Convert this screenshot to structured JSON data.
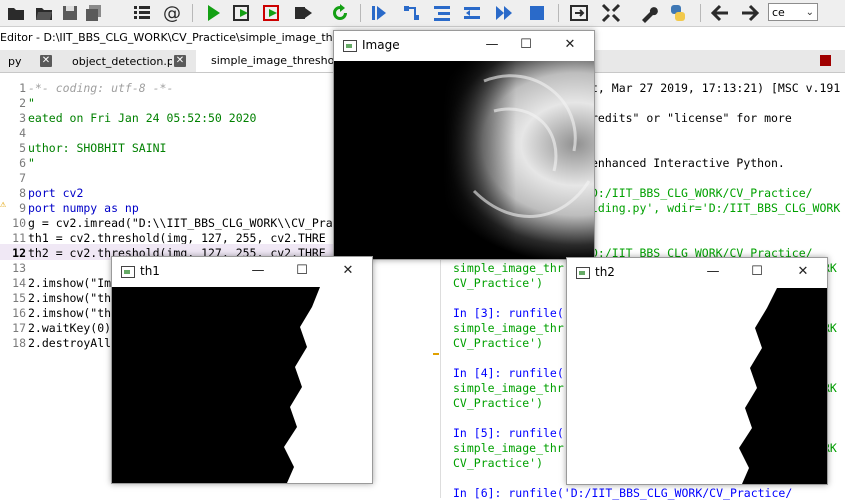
{
  "toolbar": {
    "icons": [
      "folder-open-icon",
      "save-icon",
      "save-all-icon",
      "list-icon",
      "at-icon",
      "run-icon",
      "run-cell-icon",
      "run-cell-advance-icon",
      "run-selection-icon",
      "rerun-icon",
      "debug-icon",
      "step-icon",
      "step-into-icon",
      "step-return-icon",
      "continue-icon",
      "stop-icon",
      "maximize-pane-icon",
      "fullscreen-icon",
      "wrench-icon",
      "python-icon",
      "back-icon",
      "forward-icon"
    ],
    "select_value": "ce"
  },
  "editor": {
    "title": "Editor - D:\\IIT_BBS_CLG_WORK\\CV_Practice\\simple_image_thresholding",
    "tabs": [
      {
        "label": "py"
      },
      {
        "label": "object_detection.py"
      },
      {
        "label": "simple_image_thresholding"
      }
    ],
    "lines": [
      {
        "n": "1",
        "text": "-*- coding: utf-8 -*-"
      },
      {
        "n": "2",
        "text": "\""
      },
      {
        "n": "3",
        "text": "eated on Fri Jan 24 05:52:50 2020"
      },
      {
        "n": "4",
        "text": ""
      },
      {
        "n": "5",
        "text": "uthor: SHOBHIT SAINI"
      },
      {
        "n": "6",
        "text": "\""
      },
      {
        "n": "7",
        "text": ""
      },
      {
        "n": "8",
        "text": "port cv2"
      },
      {
        "n": "9",
        "text": "port numpy as np"
      },
      {
        "n": "10",
        "text": "g = cv2.imread(\"D:\\\\IIT_BBS_CLG_WORK\\\\CV_Pra"
      },
      {
        "n": "11",
        "text": "th1 = cv2.threshold(img, 127, 255, cv2.THRE"
      },
      {
        "n": "12",
        "text": "th2 = cv2.threshold(img, 127, 255, cv2.THRE"
      },
      {
        "n": "13",
        "text": ""
      },
      {
        "n": "14",
        "text": "2.imshow(\"Im"
      },
      {
        "n": "15",
        "text": "2.imshow(\"th"
      },
      {
        "n": "16",
        "text": "2.imshow(\"th"
      },
      {
        "n": "17",
        "text": "2.waitKey(0)"
      },
      {
        "n": "18",
        "text": "2.destroyAll"
      }
    ]
  },
  "console": {
    "lines": [
      {
        "cls": "",
        "text": "t, Mar 27 2019, 17:13:21) [MSC v.191"
      },
      {
        "cls": "",
        "text": "redits\" or \"license\" for more"
      },
      {
        "cls": "",
        "text": "enhanced Interactive Python."
      },
      {
        "cls": "grn",
        "text": "D:/IIT_BBS_CLG_WORK/CV_Practice/"
      },
      {
        "cls": "grn",
        "text": "lding.py', wdir='D:/IIT_BBS_CLG_WORK"
      },
      {
        "cls": "grn",
        "text": "D:/IIT_BBS_CLG_WORK/CV_Practice/"
      },
      {
        "cls": "grn",
        "text": "simple_image_thr"
      },
      {
        "cls": "grn",
        "text": "CV_Practice')"
      },
      {
        "cls": "prompt",
        "text": "In [3]: runfile("
      },
      {
        "cls": "grn",
        "text": "simple_image_thr"
      },
      {
        "cls": "grn",
        "text": "CV_Practice')"
      },
      {
        "cls": "prompt",
        "text": "In [4]: runfile("
      },
      {
        "cls": "grn",
        "text": "simple_image_thr"
      },
      {
        "cls": "grn",
        "text": "CV_Practice')"
      },
      {
        "cls": "prompt",
        "text": "In [5]: runfile("
      },
      {
        "cls": "grn",
        "text": "simple_image_thr"
      },
      {
        "cls": "grn",
        "text": "CV_Practice')"
      },
      {
        "cls": "prompt",
        "text": "In [6]: runfile('D:/IIT_BBS_CLG_WORK/CV_Practice/"
      }
    ],
    "right_clip": [
      "RK",
      "RK",
      "RK",
      "RK",
      "RK"
    ]
  },
  "windows": {
    "image": {
      "title": "Image"
    },
    "th1": {
      "title": "th1"
    },
    "th2": {
      "title": "th2"
    },
    "controls": {
      "minimize": "—",
      "maximize": "☐",
      "close": "✕"
    }
  },
  "colors": {
    "keyword": "#0000c8",
    "string": "#008000",
    "prompt": "#0000ff",
    "run": "#14a014"
  }
}
